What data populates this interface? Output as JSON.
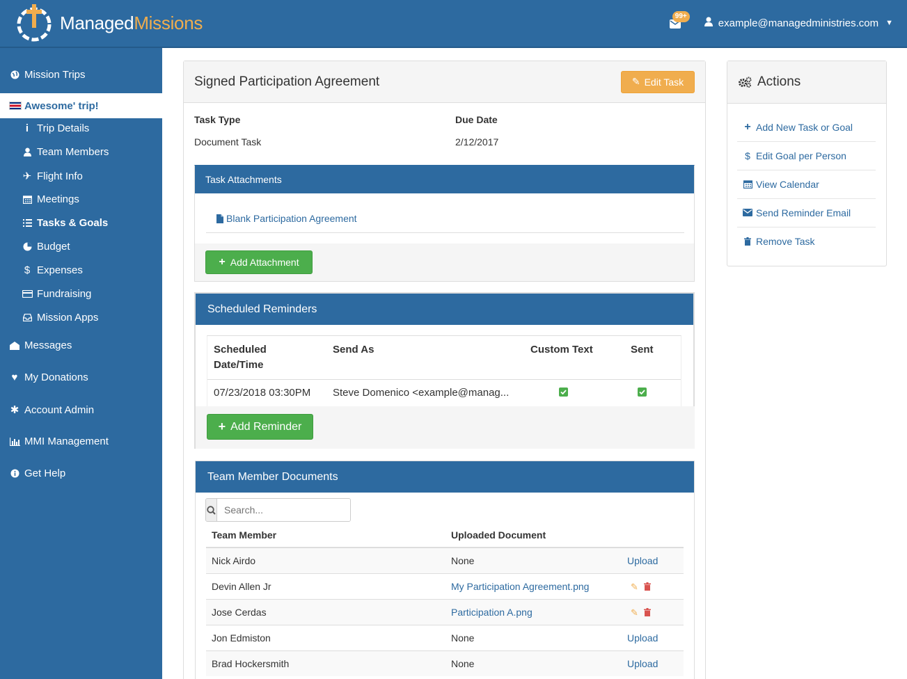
{
  "header": {
    "logo_white": "Managed",
    "logo_orange": "Missions",
    "mail_badge": "99+",
    "user_email": "example@managedministries.com"
  },
  "sidebar": {
    "mission_trips": "Mission Trips",
    "active_trip": "Awesome' trip!",
    "trip_details": "Trip Details",
    "team_members": "Team Members",
    "flight_info": "Flight Info",
    "meetings": "Meetings",
    "tasks_goals": "Tasks & Goals",
    "budget": "Budget",
    "expenses": "Expenses",
    "fundraising": "Fundraising",
    "mission_apps": "Mission Apps",
    "messages": "Messages",
    "my_donations": "My Donations",
    "account_admin": "Account Admin",
    "mmi_management": "MMI Management",
    "get_help": "Get Help"
  },
  "task": {
    "title": "Signed Participation Agreement",
    "edit_label": "Edit Task",
    "type_label": "Task Type",
    "type_value": "Document Task",
    "due_label": "Due Date",
    "due_value": "2/12/2017"
  },
  "attachments": {
    "title": "Task Attachments",
    "file": "Blank Participation Agreement",
    "add_label": "Add Attachment"
  },
  "reminders": {
    "title": "Scheduled Reminders",
    "col_date_1": "Scheduled",
    "col_date_2": "Date/Time",
    "col_send_as": "Send As",
    "col_custom": "Custom Text",
    "col_sent": "Sent",
    "rows": [
      {
        "datetime": "07/23/2018 03:30PM",
        "send_as": "Steve Domenico <example@manag...",
        "custom": true,
        "sent": true
      }
    ],
    "add_label": "Add Reminder"
  },
  "documents": {
    "title": "Team Member Documents",
    "search_placeholder": "Search...",
    "col_member": "Team Member",
    "col_doc": "Uploaded Document",
    "rows": [
      {
        "member": "Nick Airdo",
        "doc": "None",
        "action": "Upload"
      },
      {
        "member": "Devin Allen Jr",
        "doc": "My Participation Agreement.png",
        "action": ""
      },
      {
        "member": "Jose Cerdas",
        "doc": "Participation A.png",
        "action": ""
      },
      {
        "member": "Jon Edmiston",
        "doc": "None",
        "action": "Upload"
      },
      {
        "member": "Brad Hockersmith",
        "doc": "None",
        "action": "Upload"
      }
    ]
  },
  "actions": {
    "title": "Actions",
    "items": [
      "Add New Task or Goal",
      "Edit Goal per Person",
      "View Calendar",
      "Send Reminder Email",
      "Remove Task"
    ]
  },
  "colors": {
    "brand_blue": "#2d6aa0",
    "accent_orange": "#f0ad4e",
    "success_green": "#4cae4c",
    "danger_red": "#d9534f"
  }
}
